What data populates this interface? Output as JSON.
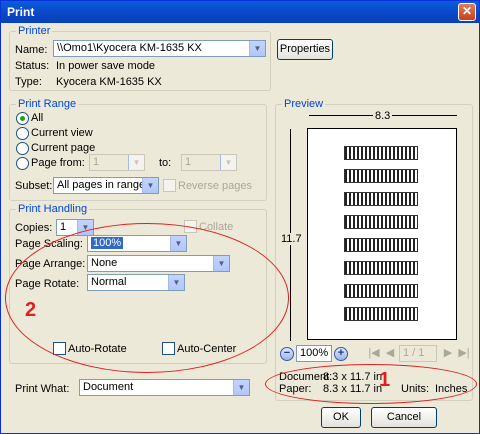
{
  "window": {
    "title": "Print",
    "close_glyph": "✕"
  },
  "printer": {
    "legend": "Printer",
    "name_label": "Name:",
    "name_value": "\\\\Omo1\\Kyocera KM-1635 KX",
    "properties_label": "Properties",
    "status_label": "Status:",
    "status_value": "In power save mode",
    "type_label": "Type:",
    "type_value": "Kyocera KM-1635 KX"
  },
  "print_range": {
    "legend": "Print Range",
    "all_label": "All",
    "current_view_label": "Current view",
    "current_page_label": "Current page",
    "page_from_label": "Page from:",
    "from_value": "1",
    "to_label": "to:",
    "to_value": "1",
    "subset_label": "Subset:",
    "subset_value": "All pages in range",
    "reverse_label": "Reverse pages"
  },
  "print_handling": {
    "legend": "Print Handling",
    "copies_label": "Copies:",
    "copies_value": "1",
    "collate_label": "Collate",
    "page_scaling_label": "Page Scaling:",
    "page_scaling_value": "100%",
    "page_arrange_label": "Page Arrange:",
    "page_arrange_value": "None",
    "page_rotate_label": "Page Rotate:",
    "page_rotate_value": "Normal",
    "auto_rotate_label": "Auto-Rotate",
    "auto_center_label": "Auto-Center"
  },
  "print_what": {
    "label": "Print What:",
    "value": "Document"
  },
  "preview": {
    "legend": "Preview",
    "width_dim": "8.3",
    "height_dim": "11.7",
    "zoom_value": "100%",
    "page_indicator": "1 / 1",
    "document_label": "Document:",
    "document_value": "8.3 x 11.7 in",
    "paper_label": "Paper:",
    "paper_value": "8.3 x 11.7 in",
    "units_label": "Units:",
    "units_value": "Inches"
  },
  "annotations": {
    "marker_1": "1",
    "marker_2": "2",
    "color": "#e02020"
  },
  "buttons": {
    "ok": "OK",
    "cancel": "Cancel"
  },
  "icons": {
    "dropdown": "▼",
    "zoom_out": "−",
    "zoom_in": "+",
    "first_page": "|◀",
    "prev_page": "◀",
    "next_page": "▶",
    "last_page": "▶|"
  }
}
